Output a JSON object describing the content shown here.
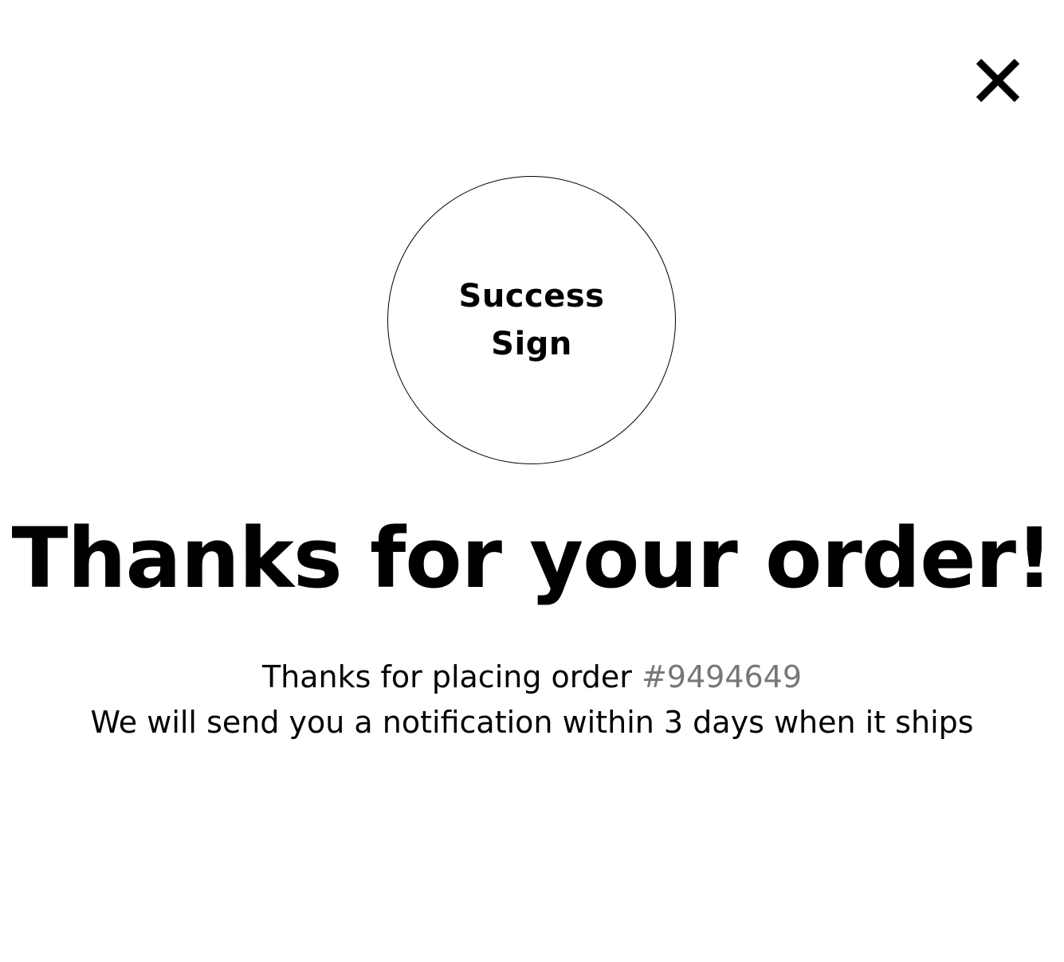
{
  "close": {
    "icon": "close-icon",
    "label": "X"
  },
  "success_sign": {
    "line1": "Success",
    "line2": "Sign"
  },
  "headline": "Thanks for your order!",
  "message": {
    "placing_prefix": "Thanks for placing order ",
    "order_number": "#9494649",
    "notification": "We will send you a notification within 3 days when it ships"
  },
  "colors": {
    "background": "#ffffff",
    "text": "#000000",
    "order_number": "#777777"
  }
}
